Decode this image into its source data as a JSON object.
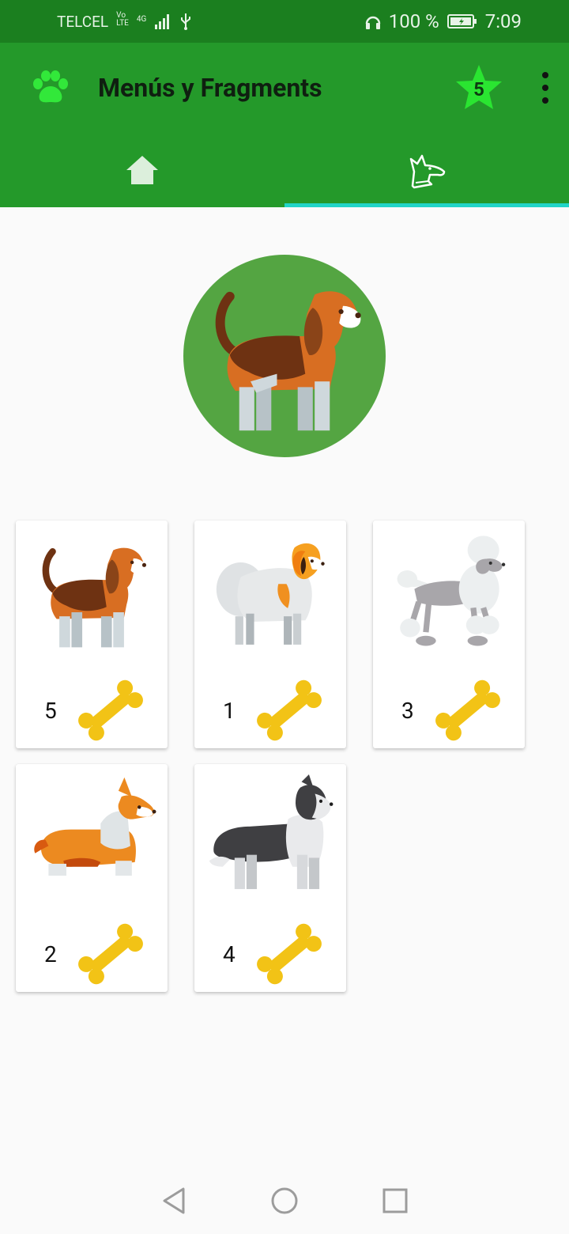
{
  "status_bar": {
    "carrier": "TELCEL",
    "volte_top": "Vo",
    "volte_bottom": "LTE",
    "network_top": "4G",
    "network_bottom": "⁴⁶",
    "battery": "100 %",
    "time": "7:09"
  },
  "app_bar": {
    "title": "Menús y Fragments",
    "favorites_count": "5",
    "logo_icon": "paw-icon",
    "colors": {
      "status": "#1b7f1f",
      "toolbar": "#24992a",
      "tab_indicator": "#21d5c7",
      "star": "#2ae531"
    }
  },
  "tabs": [
    {
      "icon": "home-icon",
      "selected": false
    },
    {
      "icon": "dog-icon",
      "selected": true
    }
  ],
  "profile": {
    "icon": "beagle-avatar"
  },
  "pets": [
    {
      "breed_icon": "beagle-icon",
      "likes": "5"
    },
    {
      "breed_icon": "papillon-icon",
      "likes": "1"
    },
    {
      "breed_icon": "poodle-icon",
      "likes": "3"
    },
    {
      "breed_icon": "corgi-icon",
      "likes": "2"
    },
    {
      "breed_icon": "border-collie-icon",
      "likes": "4"
    }
  ]
}
